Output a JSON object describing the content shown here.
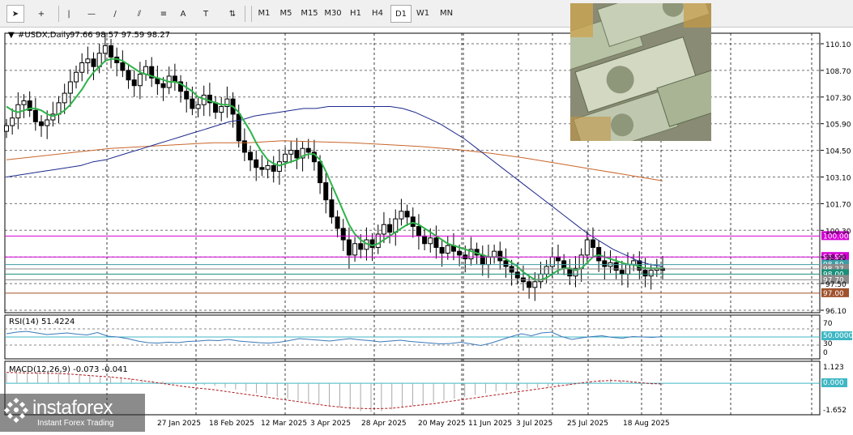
{
  "toolbar": {
    "tools": [
      {
        "name": "cursor-icon",
        "glyph": "➤"
      },
      {
        "name": "crosshair-icon",
        "glyph": "+"
      },
      {
        "name": "vertical-line-icon",
        "glyph": "|"
      },
      {
        "name": "horizontal-line-icon",
        "glyph": "—"
      },
      {
        "name": "trendline-icon",
        "glyph": "/"
      },
      {
        "name": "equidistant-channel-icon",
        "glyph": "⫽"
      },
      {
        "name": "fibonacci-icon",
        "glyph": "≡"
      },
      {
        "name": "text-icon",
        "glyph": "A"
      },
      {
        "name": "text-label-icon",
        "glyph": "T"
      },
      {
        "name": "arrows-icon",
        "glyph": "⇅"
      }
    ],
    "timeframes": [
      "M1",
      "M5",
      "M15",
      "M30",
      "H1",
      "H4",
      "D1",
      "W1",
      "MN"
    ],
    "active_timeframe": "D1"
  },
  "chart_header": {
    "symbol": "#USDX,Daily",
    "ohlc": "97.66 98.57 97.59 98.27"
  },
  "rsi_header": "RSI(14) 51.4224",
  "macd_header": "MACD(12,26,9) -0.073 -0.041",
  "logo": {
    "name": "instaforex",
    "tagline": "Instant Forex Trading"
  },
  "chart_data": {
    "type": "line",
    "symbol": "#USDX",
    "timeframe": "Daily",
    "x_tick_labels": [
      "27 Jan 2025",
      "18 Feb 2025",
      "12 Mar 2025",
      "3 Apr 2025",
      "28 Apr 2025",
      "20 May 2025",
      "11 Jun 2025",
      "3 Jul 2025",
      "25 Jul 2025",
      "18 Aug 2025"
    ],
    "y_tick_labels": [
      "110.10",
      "108.70",
      "107.30",
      "105.90",
      "104.50",
      "103.10",
      "101.70",
      "100.30",
      "98.90",
      "97.50",
      "96.10"
    ],
    "ylim": [
      96.1,
      110.1
    ],
    "close_series": [
      105.8,
      106.2,
      106.9,
      107.1,
      106.6,
      106.0,
      105.8,
      106.1,
      106.4,
      107.0,
      107.5,
      108.1,
      108.6,
      109.1,
      109.3,
      108.9,
      109.6,
      110.0,
      109.4,
      109.1,
      108.7,
      108.2,
      107.9,
      108.5,
      108.9,
      108.3,
      108.0,
      107.8,
      108.4,
      108.1,
      107.6,
      107.2,
      106.7,
      106.9,
      107.4,
      107.0,
      106.5,
      106.8,
      107.2,
      106.4,
      105.0,
      104.4,
      104.0,
      103.6,
      103.5,
      103.7,
      103.4,
      103.9,
      104.3,
      104.5,
      104.1,
      104.6,
      104.4,
      103.9,
      102.8,
      101.9,
      101.0,
      100.4,
      99.8,
      99.0,
      99.6,
      99.3,
      99.8,
      99.4,
      100.1,
      100.6,
      100.2,
      100.9,
      101.3,
      101.0,
      100.5,
      100.0,
      99.6,
      99.9,
      99.4,
      99.1,
      99.5,
      99.2,
      99.0,
      98.8,
      99.3,
      99.0,
      98.5,
      98.9,
      99.2,
      98.7,
      98.4,
      98.1,
      97.8,
      97.6,
      97.3,
      97.6,
      98.0,
      98.4,
      98.9,
      98.7,
      98.3,
      97.9,
      98.3,
      99.0,
      99.8,
      99.4,
      98.7,
      98.4,
      98.6,
      98.2,
      98.0,
      98.5,
      98.7,
      98.2,
      97.9,
      98.2,
      98.3,
      98.2
    ],
    "ma_fast_series": [
      106.8,
      106.6,
      106.5,
      106.6,
      106.7,
      106.7,
      106.6,
      106.4,
      106.3,
      106.4,
      106.6,
      106.9,
      107.3,
      107.7,
      108.2,
      108.6,
      108.9,
      109.2,
      109.3,
      109.3,
      109.2,
      109.0,
      108.8,
      108.6,
      108.5,
      108.4,
      108.3,
      108.2,
      108.1,
      108.1,
      108.0,
      107.8,
      107.6,
      107.3,
      107.2,
      107.1,
      107.0,
      106.9,
      106.9,
      106.8,
      106.5,
      106.0,
      105.5,
      104.9,
      104.4,
      104.0,
      103.8,
      103.7,
      103.8,
      103.9,
      104.0,
      104.2,
      104.3,
      104.3,
      104.0,
      103.4,
      102.7,
      102.0,
      101.3,
      100.6,
      100.1,
      99.8,
      99.6,
      99.5,
      99.6,
      99.8,
      100.0,
      100.2,
      100.4,
      100.6,
      100.7,
      100.6,
      100.4,
      100.2,
      100.0,
      99.8,
      99.6,
      99.5,
      99.4,
      99.3,
      99.2,
      99.1,
      99.0,
      98.9,
      98.9,
      98.9,
      98.8,
      98.6,
      98.4,
      98.1,
      97.9,
      97.7,
      97.7,
      97.8,
      98.0,
      98.2,
      98.3,
      98.3,
      98.2,
      98.3,
      98.6,
      98.9,
      99.0,
      98.9,
      98.8,
      98.7,
      98.6,
      98.5,
      98.5,
      98.4,
      98.3,
      98.3,
      98.3,
      98.3
    ],
    "ma_mid_series": [
      103.1,
      103.2,
      103.3,
      103.4,
      103.5,
      103.6,
      103.7,
      103.9,
      104.0,
      104.2,
      104.4,
      104.6,
      104.8,
      105.0,
      105.2,
      105.4,
      105.6,
      105.8,
      106.0,
      106.1,
      106.3,
      106.4,
      106.5,
      106.6,
      106.7,
      106.7,
      106.8,
      106.8,
      106.8,
      106.8,
      106.8,
      106.8,
      106.7,
      106.5,
      106.2,
      105.9,
      105.5,
      105.1,
      104.6,
      104.1,
      103.6,
      103.1,
      102.6,
      102.1,
      101.6,
      101.1,
      100.6,
      100.1,
      99.7,
      99.3,
      99.0,
      98.7,
      98.5,
      98.4
    ],
    "ma_slow_series": [
      104.0,
      104.2,
      104.4,
      104.6,
      104.7,
      104.8,
      104.9,
      104.9,
      105.0,
      104.95,
      104.9,
      104.8,
      104.7,
      104.55,
      104.35,
      104.1,
      103.8,
      103.5,
      103.2,
      102.9
    ],
    "horizontal_levels": [
      {
        "value": "100.00",
        "color": "#d400d4"
      },
      {
        "value": "98.90",
        "color": "#d400d4"
      },
      {
        "value": "98.50",
        "color": "#3d9ca4"
      },
      {
        "value": "98.27",
        "color": "#8a8a8a"
      },
      {
        "value": "98.00",
        "color": "#1a8f7a"
      },
      {
        "value": "97.70",
        "color": "#8a8a8a"
      },
      {
        "value": "97.00",
        "color": "#a0522d"
      }
    ],
    "rsi": {
      "name": "RSI(14)",
      "value": "51.4224",
      "levels": [
        "70",
        "50.0000",
        "30",
        "0"
      ],
      "ylim": [
        0,
        100
      ],
      "series": [
        58,
        62,
        64,
        60,
        56,
        58,
        60,
        57,
        55,
        61,
        52,
        50,
        46,
        40,
        36,
        35,
        37,
        36,
        39,
        40,
        42,
        41,
        44,
        40,
        38,
        36,
        35,
        37,
        41,
        46,
        44,
        42,
        40,
        43,
        46,
        43,
        41,
        38,
        40,
        42,
        39,
        37,
        35,
        33,
        34,
        37,
        33,
        29,
        35,
        43,
        51,
        58,
        53,
        60,
        62,
        51,
        44,
        48,
        51,
        53,
        49,
        47,
        51,
        50,
        49,
        51
      ]
    },
    "macd": {
      "name": "MACD(12,26,9)",
      "main": "-0.073",
      "signal": "-0.041",
      "levels": [
        "1.123",
        "0.000",
        "-1.652"
      ],
      "ylim": [
        -1.652,
        1.123
      ],
      "histogram": [
        0.55,
        0.55,
        0.58,
        0.6,
        0.62,
        0.6,
        0.55,
        0.5,
        0.45,
        0.4,
        0.35,
        0.3,
        0.25,
        0.2,
        0.15,
        0.1,
        0.05,
        0.0,
        -0.05,
        -0.1,
        -0.15,
        -0.25,
        -0.35,
        -0.45,
        -0.55,
        -0.65,
        -0.75,
        -0.85,
        -0.95,
        -1.05,
        -1.15,
        -1.25,
        -1.35,
        -1.45,
        -1.55,
        -1.6,
        -1.55,
        -1.45,
        -1.35,
        -1.25,
        -1.15,
        -1.05,
        -0.95,
        -0.85,
        -0.75,
        -0.65,
        -0.55,
        -0.45,
        -0.4,
        -0.35,
        -0.3,
        -0.25,
        -0.2,
        -0.15,
        -0.1,
        0.0,
        0.1,
        0.2,
        0.25,
        0.15,
        0.05,
        -0.05,
        -0.08,
        -0.07
      ],
      "signal_series": [
        0.6,
        0.58,
        0.56,
        0.55,
        0.54,
        0.5,
        0.45,
        0.4,
        0.35,
        0.28,
        0.2,
        0.1,
        0.0,
        -0.1,
        -0.2,
        -0.28,
        -0.35,
        -0.45,
        -0.55,
        -0.65,
        -0.75,
        -0.85,
        -0.95,
        -1.05,
        -1.15,
        -1.25,
        -1.32,
        -1.38,
        -1.4,
        -1.4,
        -1.38,
        -1.3,
        -1.22,
        -1.15,
        -1.05,
        -0.95,
        -0.85,
        -0.75,
        -0.65,
        -0.55,
        -0.45,
        -0.35,
        -0.25,
        -0.15,
        -0.05,
        0.05,
        0.12,
        0.15,
        0.12,
        0.05,
        -0.02,
        -0.04
      ]
    }
  }
}
